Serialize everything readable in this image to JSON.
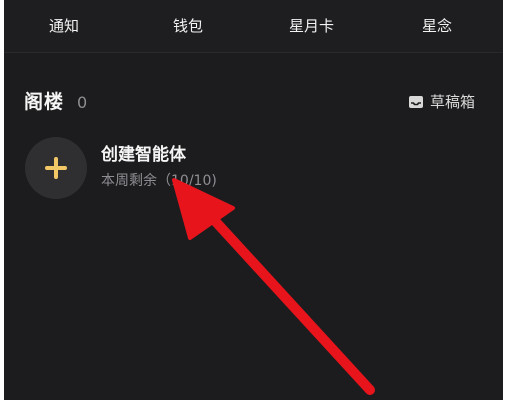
{
  "nav": {
    "items": [
      {
        "label": "通知"
      },
      {
        "label": "钱包"
      },
      {
        "label": "星月卡"
      },
      {
        "label": "星念"
      }
    ]
  },
  "section": {
    "title": "阁楼",
    "count": "0",
    "drafts_label": "草稿箱",
    "drafts_icon": "inbox-tray-icon"
  },
  "create": {
    "title": "创建智能体",
    "remaining": "本周剩余（10/10)",
    "icon": "plus-icon",
    "accent": "#f3c766"
  },
  "annotation": {
    "arrow_color": "#e8141c"
  }
}
